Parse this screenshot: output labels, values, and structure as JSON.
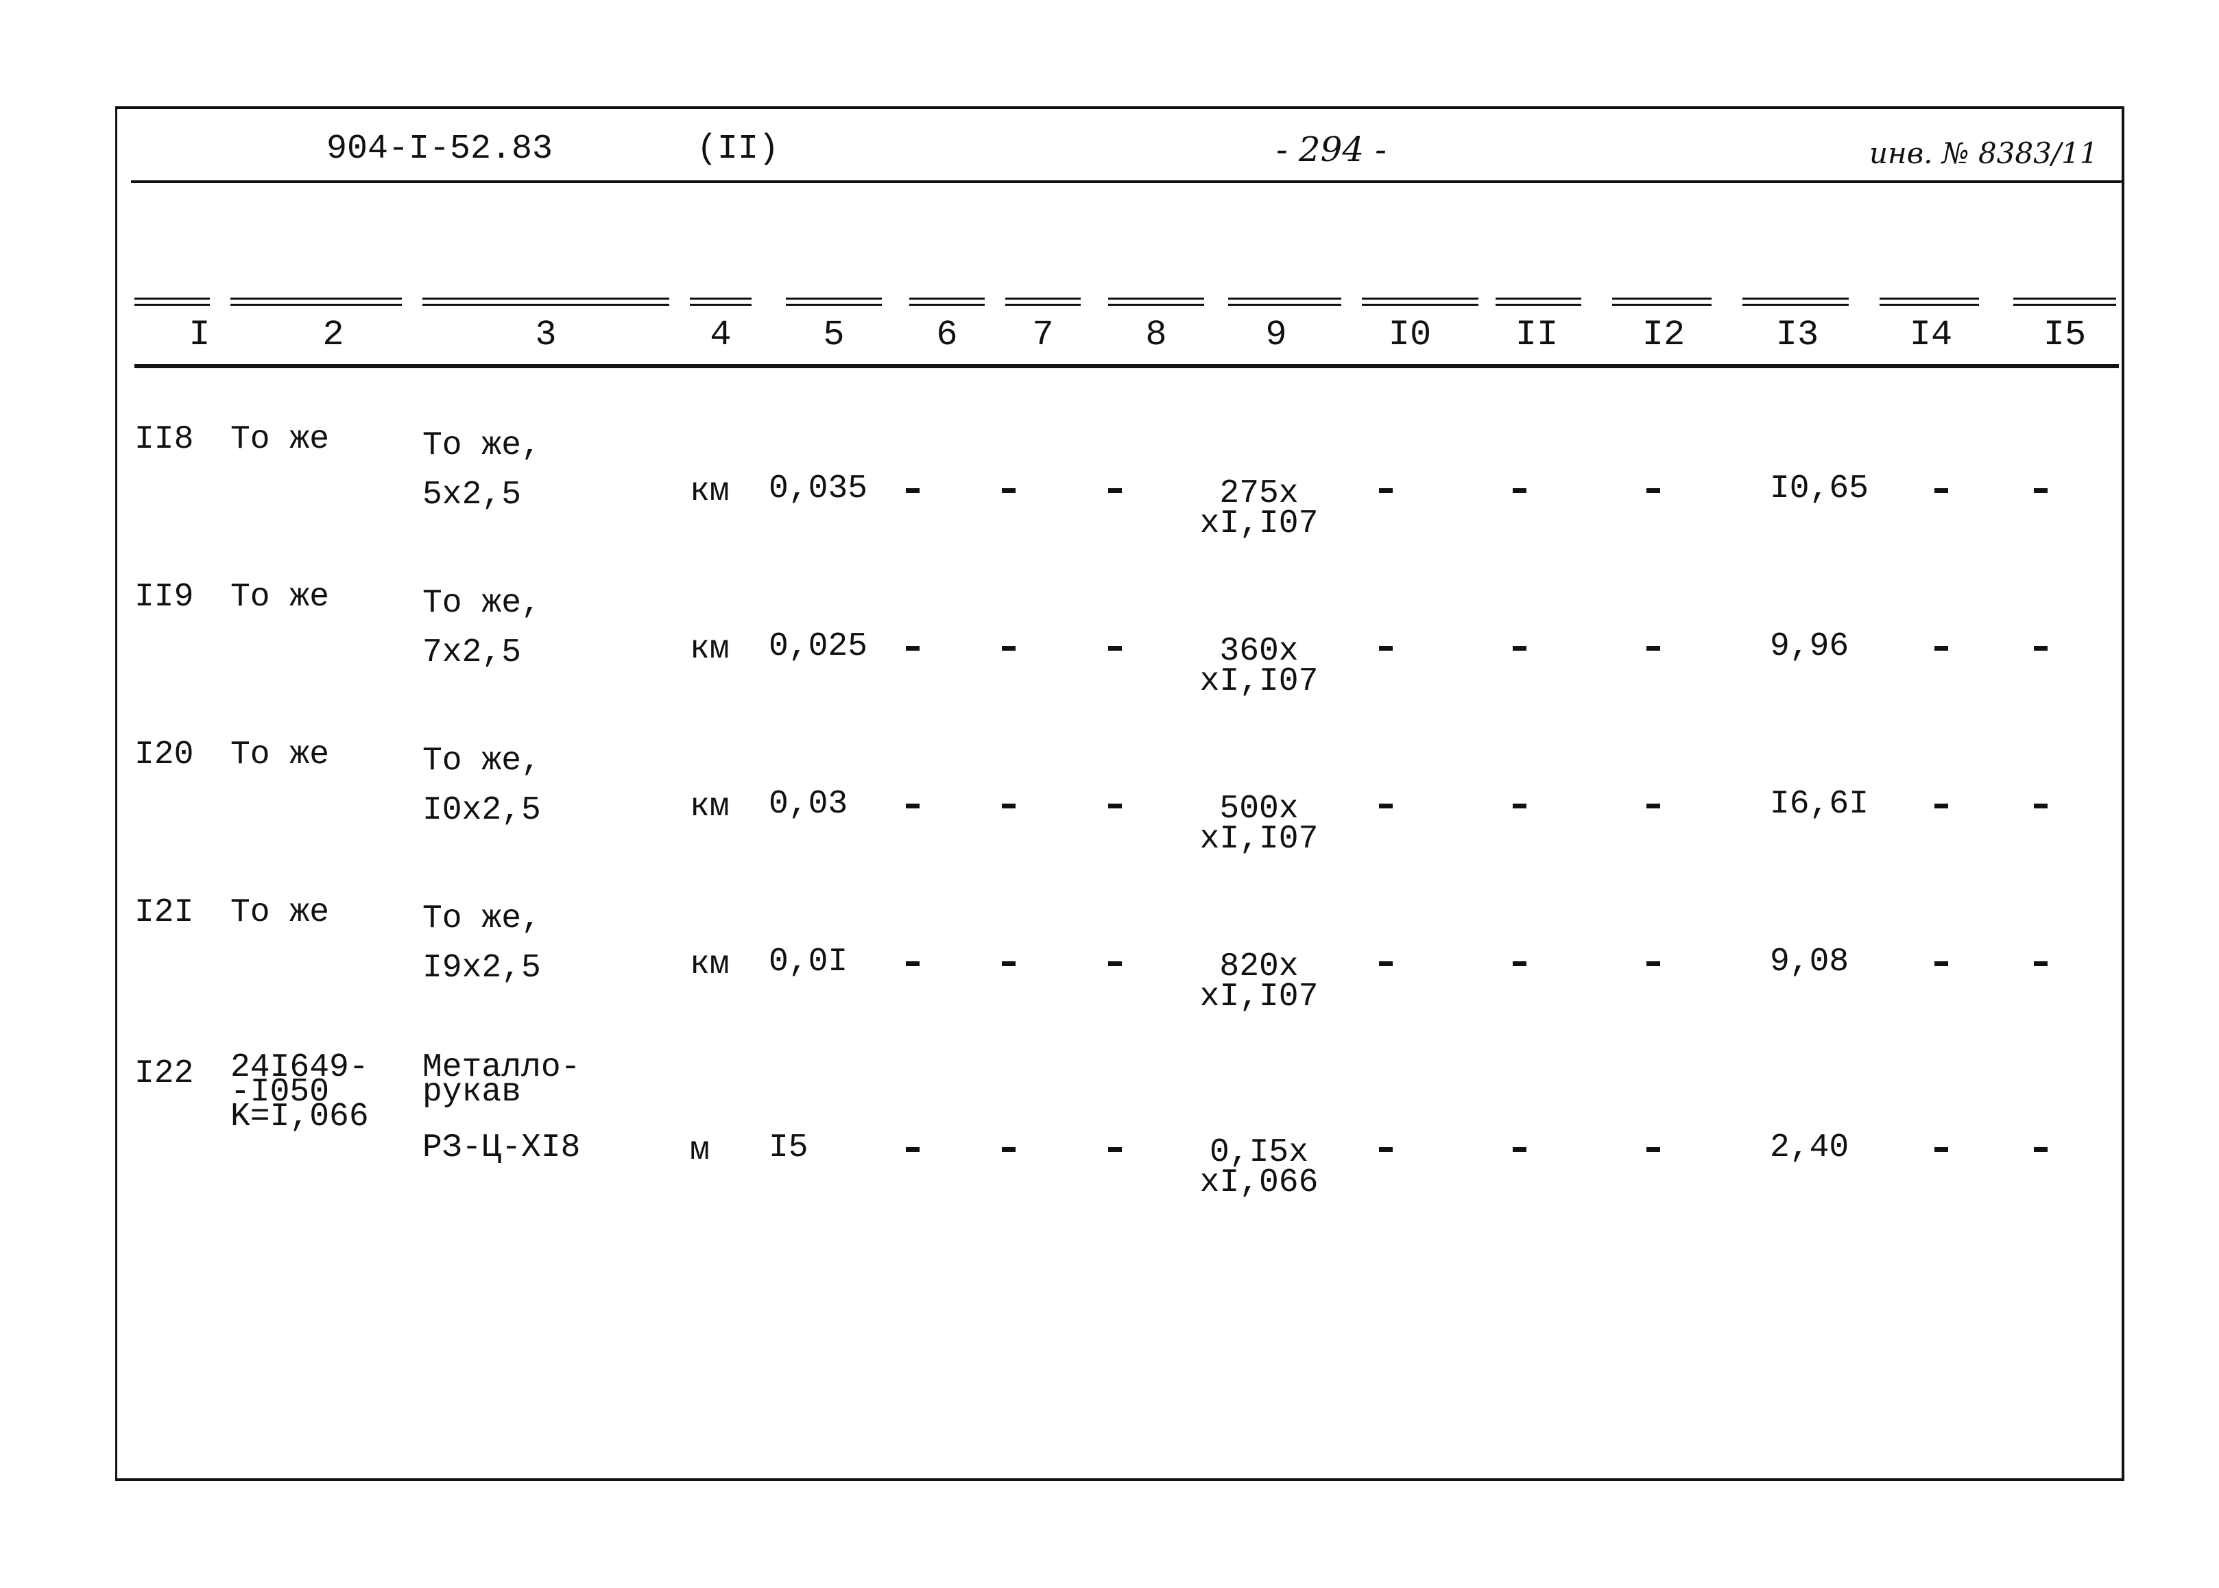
{
  "header": {
    "doc_code": "904-I-52.83",
    "sheet": "(II)",
    "page": "- 294 -",
    "inventory": "инв. № 8383/11"
  },
  "columns": [
    "I",
    "2",
    "3",
    "4",
    "5",
    "6",
    "7",
    "8",
    "9",
    "I0",
    "II",
    "I2",
    "I3",
    "I4",
    "I5"
  ],
  "rows": [
    {
      "no": "II8",
      "code": [
        "То же"
      ],
      "name": [
        "То же,",
        "5x2,5"
      ],
      "unit": "км",
      "qty": "0,035",
      "c6": "-",
      "c7": "-",
      "c8": "-",
      "c9": [
        "275x",
        "xI,I07"
      ],
      "c10": "-",
      "c11": "-",
      "c12": "-",
      "c13": "I0,65",
      "c14": "-",
      "c15": "-"
    },
    {
      "no": "II9",
      "code": [
        "То же"
      ],
      "name": [
        "То же,",
        "7x2,5"
      ],
      "unit": "км",
      "qty": "0,025",
      "c6": "-",
      "c7": "-",
      "c8": "-",
      "c9": [
        "360x",
        "xI,I07"
      ],
      "c10": "-",
      "c11": "-",
      "c12": "-",
      "c13": "9,96",
      "c14": "-",
      "c15": "-"
    },
    {
      "no": "I20",
      "code": [
        "То же"
      ],
      "name": [
        "То же,",
        "I0x2,5"
      ],
      "unit": "км",
      "qty": "0,03",
      "c6": "-",
      "c7": "-",
      "c8": "-",
      "c9": [
        "500x",
        "xI,I07"
      ],
      "c10": "-",
      "c11": "-",
      "c12": "-",
      "c13": "I6,6I",
      "c14": "-",
      "c15": "-"
    },
    {
      "no": "I2I",
      "code": [
        "То же"
      ],
      "name": [
        "То же,",
        "I9x2,5"
      ],
      "unit": "км",
      "qty": "0,0I",
      "c6": "-",
      "c7": "-",
      "c8": "-",
      "c9": [
        "820x",
        "xI,I07"
      ],
      "c10": "-",
      "c11": "-",
      "c12": "-",
      "c13": "9,08",
      "c14": "-",
      "c15": "-"
    },
    {
      "no": "I22",
      "code": [
        "24I649-",
        "-I050",
        "K=I,066"
      ],
      "name": [
        "Металло-",
        "рукав",
        "РЗ-Ц-XI8"
      ],
      "unit": "м",
      "qty": "I5",
      "c6": "-",
      "c7": "-",
      "c8": "-",
      "c9": [
        "0,I5x",
        "xI,066"
      ],
      "c10": "-",
      "c11": "-",
      "c12": "-",
      "c13": "2,40",
      "c14": "-",
      "c15": "-"
    }
  ]
}
